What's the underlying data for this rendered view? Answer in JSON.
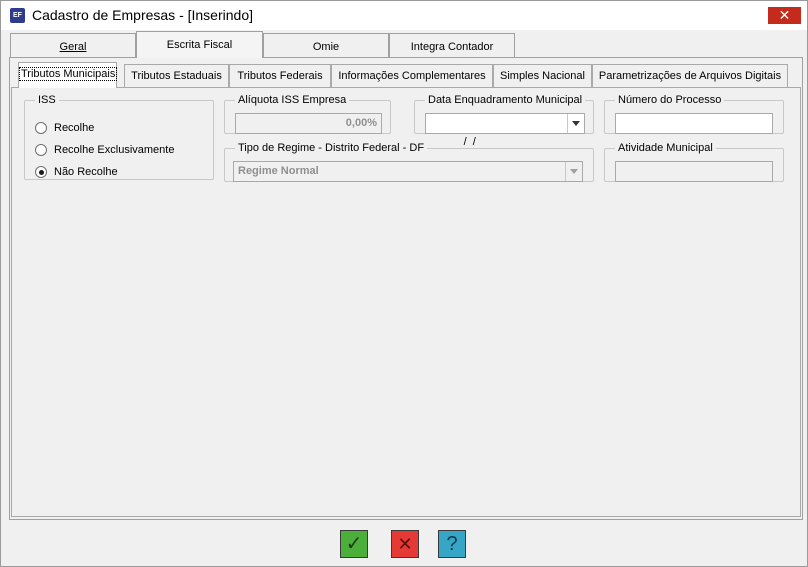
{
  "window": {
    "app_icon": "EF",
    "title": "Cadastro de Empresas - [Inserindo]",
    "close_glyph": "✕"
  },
  "main_tabs": [
    {
      "label": "Geral",
      "active": false
    },
    {
      "label": "Escrita Fiscal",
      "active": true
    },
    {
      "label": "Omie",
      "active": false
    },
    {
      "label": "Integra Contador",
      "active": false
    }
  ],
  "sub_tabs": [
    {
      "label": "Tributos Municipais",
      "active": true
    },
    {
      "label": "Tributos Estaduais",
      "active": false
    },
    {
      "label": "Tributos Federais",
      "active": false
    },
    {
      "label": "Informações Complementares",
      "active": false
    },
    {
      "label": "Simples Nacional",
      "active": false
    },
    {
      "label": "Parametrizações de Arquivos Digitais",
      "active": false
    }
  ],
  "iss": {
    "legend": "ISS",
    "options": [
      {
        "label": "Recolhe",
        "checked": false
      },
      {
        "label": "Recolhe Exclusivamente",
        "checked": false
      },
      {
        "label": "Não Recolhe",
        "checked": true
      }
    ]
  },
  "aliquota": {
    "legend": "Alíquota ISS Empresa",
    "value": "0,00%"
  },
  "data_enquadramento": {
    "legend": "Data Enquadramento Municipal",
    "value": " /  /"
  },
  "numero_processo": {
    "legend": "Número do Processo",
    "value": ""
  },
  "tipo_regime": {
    "legend": "Tipo de Regime - Distrito Federal - DF",
    "value": "Regime Normal"
  },
  "atividade_municipal": {
    "legend": "Atividade Municipal",
    "value": ""
  },
  "actions": {
    "confirm": {
      "glyph": "✓",
      "color": "#4caf3a"
    },
    "cancel": {
      "glyph": "✕",
      "color": "#e53935"
    },
    "help": {
      "glyph": "?",
      "color": "#36a6c7"
    }
  }
}
